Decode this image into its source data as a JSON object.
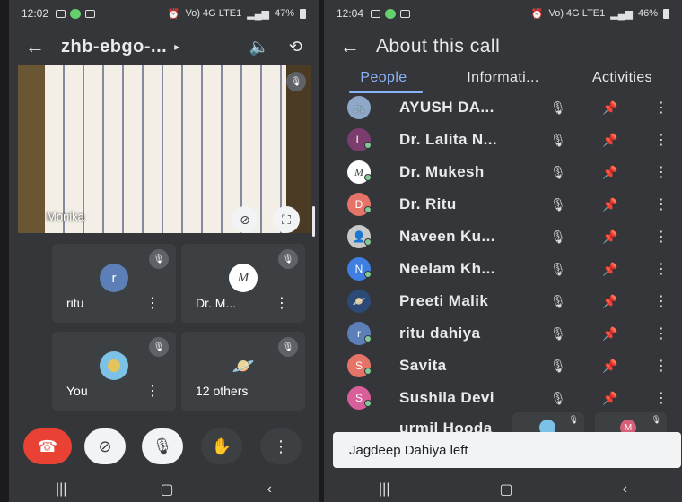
{
  "left": {
    "status": {
      "time": "12:02",
      "battery": "47%",
      "net": "Vo) 4G LTE1"
    },
    "title": "zhb-ebgo-...",
    "presenter": "Monika",
    "tiles": [
      {
        "name": "ritu",
        "initial": "r",
        "color": "#5b7fb6"
      },
      {
        "name": "Dr. M...",
        "initial": "M",
        "color": "#ffffff"
      },
      {
        "name": "You",
        "initial": "",
        "color": "#7cc1e6"
      },
      {
        "name": "12 others",
        "initial": "",
        "color": "#3c4043"
      }
    ],
    "controls": {
      "end_call_color": "#e94235"
    }
  },
  "right": {
    "status": {
      "time": "12:04",
      "battery": "46%",
      "net": "Vo) 4G LTE1"
    },
    "title": "About this call",
    "tabs": [
      "People",
      "Informati...",
      "Activities"
    ],
    "people": [
      {
        "name": "AYUSH DA...",
        "initial": "",
        "color": "#8fa8c9"
      },
      {
        "name": "Dr. Lalita N...",
        "initial": "L",
        "color": "#7a3d6e"
      },
      {
        "name": "Dr. Mukesh",
        "initial": "M",
        "color": "#ffffff"
      },
      {
        "name": "Dr. Ritu",
        "initial": "D",
        "color": "#e57368"
      },
      {
        "name": "Naveen Ku...",
        "initial": "",
        "color": "#c9c9c9"
      },
      {
        "name": "Neelam Kh...",
        "initial": "N",
        "color": "#3f7fe2"
      },
      {
        "name": "Preeti Malik",
        "initial": "",
        "color": "#2b4a78"
      },
      {
        "name": "ritu dahiya",
        "initial": "r",
        "color": "#5b7fb6"
      },
      {
        "name": "Savita",
        "initial": "S",
        "color": "#e57368"
      },
      {
        "name": "Sushila Devi",
        "initial": "S",
        "color": "#d85f9a"
      },
      {
        "name": "urmil Hooda",
        "initial": "",
        "color": "#9aa0a6"
      }
    ],
    "mini_tiles": [
      {
        "initial": "",
        "color": "#7cc1e6"
      },
      {
        "initial": "M",
        "color": "#d85f7a"
      }
    ],
    "toast": "Jagdeep Dahiya left"
  },
  "colors": {
    "accent": "#8ab4f8",
    "bg": "#35363a",
    "tile": "#3c4043"
  }
}
